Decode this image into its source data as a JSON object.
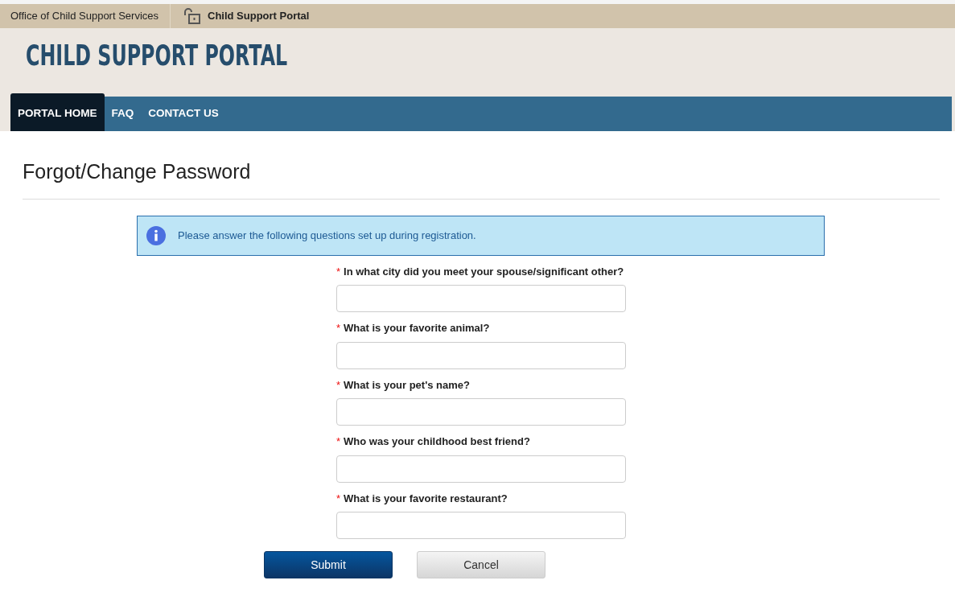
{
  "breadcrumb": [
    {
      "label": "Office of Child Support Services",
      "current": false
    },
    {
      "label": "Child Support Portal",
      "current": true
    }
  ],
  "site_title": "CHILD SUPPORT PORTAL",
  "nav": [
    {
      "label": "PORTAL HOME",
      "selected": true
    },
    {
      "label": "FAQ",
      "selected": false
    },
    {
      "label": "CONTACT US",
      "selected": false
    }
  ],
  "page_title": "Forgot/Change Password",
  "alert": {
    "text": "Please answer the following questions set up during registration."
  },
  "questions": [
    {
      "mark": "*",
      "label": "In what city did you meet your spouse/significant other?"
    },
    {
      "mark": "*",
      "label": "What is your favorite animal?"
    },
    {
      "mark": "*",
      "label": "What is your pet's name?"
    },
    {
      "mark": "*",
      "label": "Who was your childhood best friend?"
    },
    {
      "mark": "*",
      "label": "What is your favorite restaurant?"
    }
  ],
  "buttons": [
    {
      "label": "Submit",
      "kind": "primary"
    },
    {
      "label": "Cancel",
      "kind": "secondary"
    }
  ]
}
